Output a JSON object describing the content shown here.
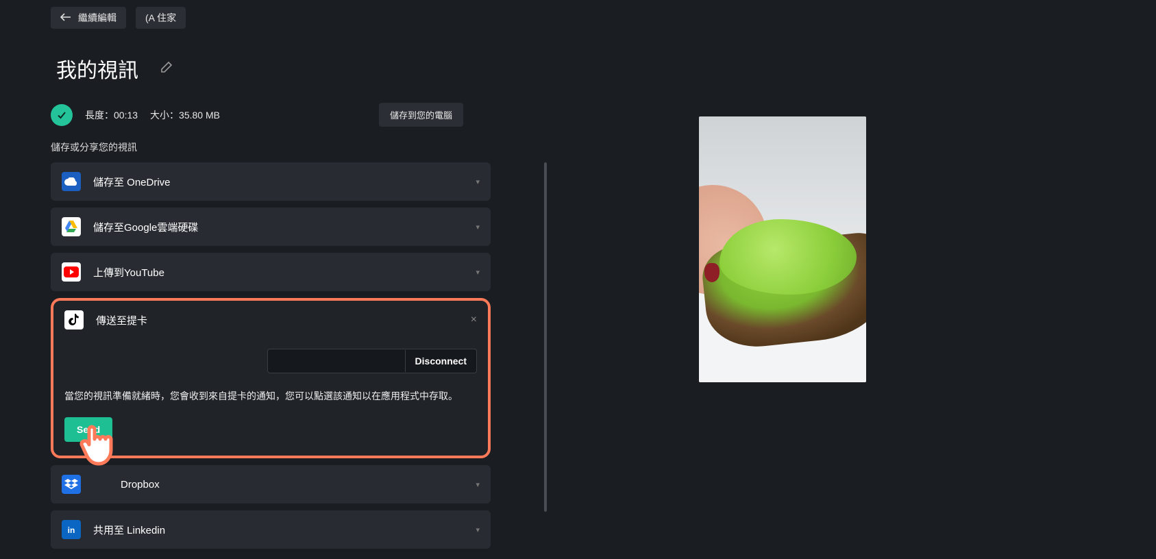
{
  "topbar": {
    "back_label": "繼續編輯",
    "home_label": "(A 住家"
  },
  "title": "我的視訊",
  "meta": {
    "length_label": "長度：",
    "length_value": "00:13",
    "size_label": "大小：",
    "size_value": "35.80 MB",
    "save_pc_label": "儲存到您的電腦"
  },
  "section_label": "儲存或分享您的視訊",
  "destinations": {
    "onedrive": {
      "label": "儲存至 OneDrive"
    },
    "gdrive": {
      "label": "儲存至Google雲端硬碟"
    },
    "youtube": {
      "label": "上傳到YouTube"
    },
    "tiktok": {
      "label": "傳送至提卡",
      "disconnect_label": "Disconnect",
      "note": "當您的視訊準備就緒時，您會收到來自提卡的通知，您可以點選該通知以在應用程式中存取。",
      "send_label": "Send"
    },
    "dropbox": {
      "label": "Dropbox"
    },
    "linkedin": {
      "label": "共用至 Linkedin"
    }
  }
}
